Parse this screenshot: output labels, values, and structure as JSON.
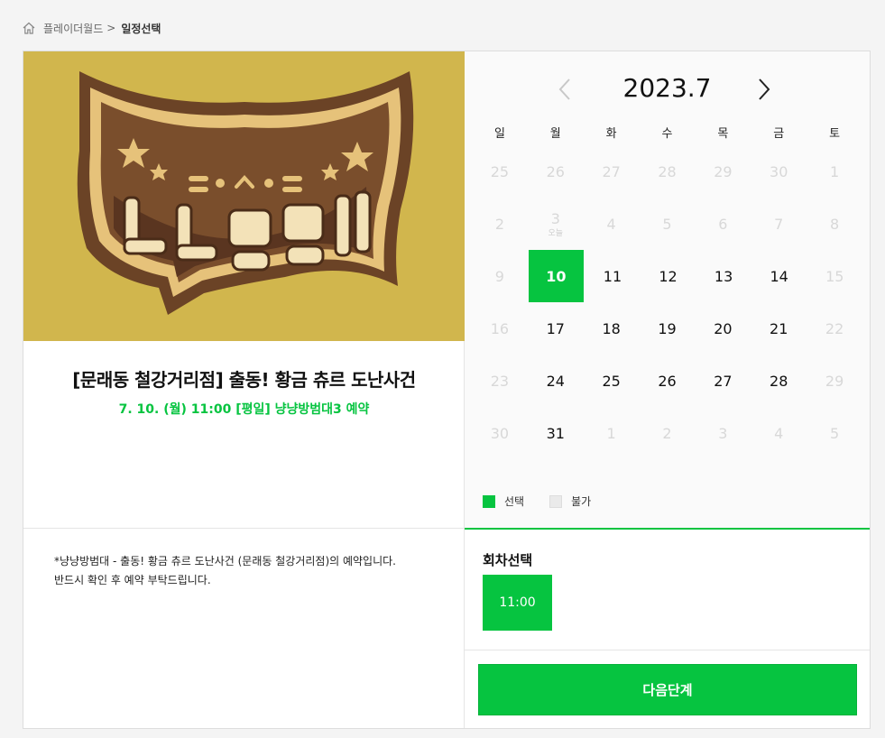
{
  "breadcrumb": {
    "home": "플레이더월드",
    "separator": ">",
    "current": "일정선택"
  },
  "poster": {
    "logo_text": "냥냥방범대",
    "background": "#d1b64d"
  },
  "event": {
    "title": "[문래동 철강거리점] 출동! 황금 츄르 도난사건",
    "subtitle": "7. 10. (월) 11:00 [평일] 냥냥방범대3 예약"
  },
  "notice": {
    "line1": "*냥냥방범대 - 출동! 황금 츄르 도난사건 (문래동 철강거리점)의 예약입니다.",
    "line2": "반드시 확인 후 예약 부탁드립니다."
  },
  "calendar": {
    "month_label": "2023.7",
    "weekdays": [
      "일",
      "월",
      "화",
      "수",
      "목",
      "금",
      "토"
    ],
    "today_label": "오늘",
    "weeks": [
      [
        {
          "d": "25",
          "s": "dim"
        },
        {
          "d": "26",
          "s": "dim"
        },
        {
          "d": "27",
          "s": "dim"
        },
        {
          "d": "28",
          "s": "dim"
        },
        {
          "d": "29",
          "s": "dim"
        },
        {
          "d": "30",
          "s": "dim"
        },
        {
          "d": "1",
          "s": "dim"
        }
      ],
      [
        {
          "d": "2",
          "s": "dim"
        },
        {
          "d": "3",
          "s": "dim",
          "today": true
        },
        {
          "d": "4",
          "s": "dim"
        },
        {
          "d": "5",
          "s": "dim"
        },
        {
          "d": "6",
          "s": "dim"
        },
        {
          "d": "7",
          "s": "dim"
        },
        {
          "d": "8",
          "s": "dim"
        }
      ],
      [
        {
          "d": "9",
          "s": "dim"
        },
        {
          "d": "10",
          "s": "selected"
        },
        {
          "d": "11",
          "s": "on"
        },
        {
          "d": "12",
          "s": "on"
        },
        {
          "d": "13",
          "s": "on"
        },
        {
          "d": "14",
          "s": "on"
        },
        {
          "d": "15",
          "s": "dim"
        }
      ],
      [
        {
          "d": "16",
          "s": "dim"
        },
        {
          "d": "17",
          "s": "on"
        },
        {
          "d": "18",
          "s": "on"
        },
        {
          "d": "19",
          "s": "on"
        },
        {
          "d": "20",
          "s": "on"
        },
        {
          "d": "21",
          "s": "on"
        },
        {
          "d": "22",
          "s": "dim"
        }
      ],
      [
        {
          "d": "23",
          "s": "dim"
        },
        {
          "d": "24",
          "s": "on"
        },
        {
          "d": "25",
          "s": "on"
        },
        {
          "d": "26",
          "s": "on"
        },
        {
          "d": "27",
          "s": "on"
        },
        {
          "d": "28",
          "s": "on"
        },
        {
          "d": "29",
          "s": "dim"
        }
      ],
      [
        {
          "d": "30",
          "s": "dim"
        },
        {
          "d": "31",
          "s": "on"
        },
        {
          "d": "1",
          "s": "dim"
        },
        {
          "d": "2",
          "s": "dim"
        },
        {
          "d": "3",
          "s": "dim"
        },
        {
          "d": "4",
          "s": "dim"
        },
        {
          "d": "5",
          "s": "dim"
        }
      ]
    ]
  },
  "legend": {
    "selected": "선택",
    "unavailable": "불가"
  },
  "session": {
    "title": "회차선택",
    "slots": [
      "11:00"
    ]
  },
  "next_button": "다음단계",
  "colors": {
    "accent": "#06c440",
    "disabled": "#eaeaea"
  }
}
